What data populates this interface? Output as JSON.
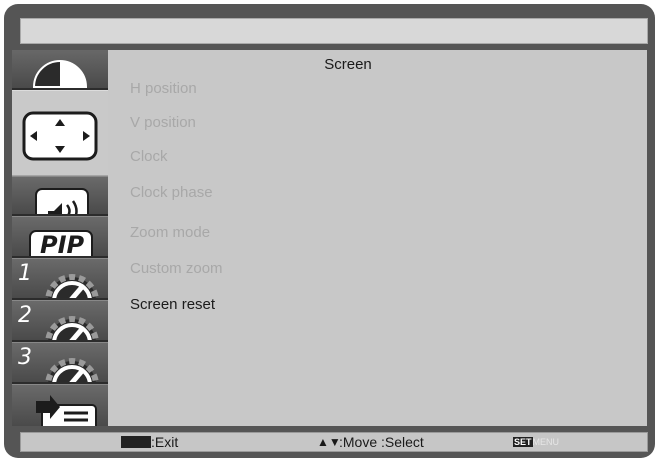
{
  "menu": {
    "title": "Screen",
    "items": [
      {
        "label": "H position",
        "enabled": false
      },
      {
        "label": "V position",
        "enabled": false
      },
      {
        "label": "Clock",
        "enabled": false
      },
      {
        "label": "Clock phase",
        "enabled": false
      },
      {
        "label": "Zoom mode",
        "enabled": false
      },
      {
        "label": "Custom zoom",
        "enabled": false
      },
      {
        "label": "Screen reset",
        "enabled": true
      }
    ]
  },
  "sidebar": {
    "selected_index": 1,
    "tabs": [
      {
        "icon": "picture-icon"
      },
      {
        "icon": "screen-position-icon"
      },
      {
        "icon": "audio-icon"
      },
      {
        "icon": "pip-icon",
        "label": "PIP"
      },
      {
        "icon": "configuration-icon",
        "label": "1"
      },
      {
        "icon": "configuration-icon",
        "label": "2"
      },
      {
        "icon": "configuration-icon",
        "label": "3"
      },
      {
        "icon": "advanced-option-icon"
      }
    ]
  },
  "footer": {
    "exit_label": ":Exit",
    "move_arrows": "▲▼",
    "move_label": ":Move :Select",
    "set_key": "SET",
    "menu_key": "MENU"
  },
  "colors": {
    "frame": "#555555",
    "content_bg": "#c8c8c8",
    "disabled_text": "#a8a8a8",
    "enabled_text": "#1c1c1c"
  }
}
